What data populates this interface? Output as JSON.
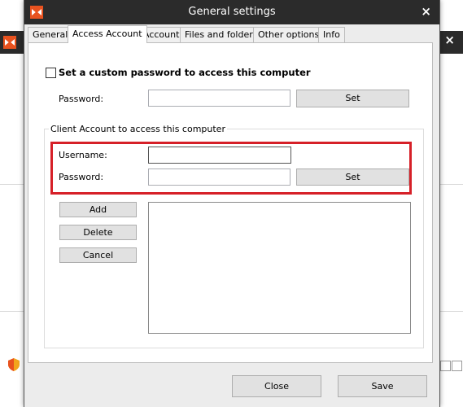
{
  "dialog": {
    "title": "General settings",
    "close_glyph": "×"
  },
  "tabs": [
    {
      "label": "General"
    },
    {
      "label": "Access Account",
      "active": true
    },
    {
      "label": "Account"
    },
    {
      "label": "Files and folders"
    },
    {
      "label": "Other options"
    },
    {
      "label": "Info"
    }
  ],
  "custom_password": {
    "checkbox_label": "Set a custom password to access this computer",
    "checked": false,
    "password_label": "Password:",
    "password_value": "",
    "set_label": "Set"
  },
  "client_account": {
    "group_title": "Client Account to access this computer",
    "username_label": "Username:",
    "username_value": "",
    "password_label": "Password:",
    "password_value": "",
    "set_label": "Set",
    "highlight_color": "#d62028"
  },
  "account_actions": {
    "add_label": "Add",
    "delete_label": "Delete",
    "cancel_label": "Cancel"
  },
  "footer": {
    "close_label": "Close",
    "save_label": "Save"
  },
  "background_window": {
    "close_glyph": "×"
  },
  "colors": {
    "titlebar": "#2b2b2b",
    "logo_accent": "#e8521f",
    "dialog_bg": "#ececec",
    "panel_bg": "#ffffff"
  }
}
